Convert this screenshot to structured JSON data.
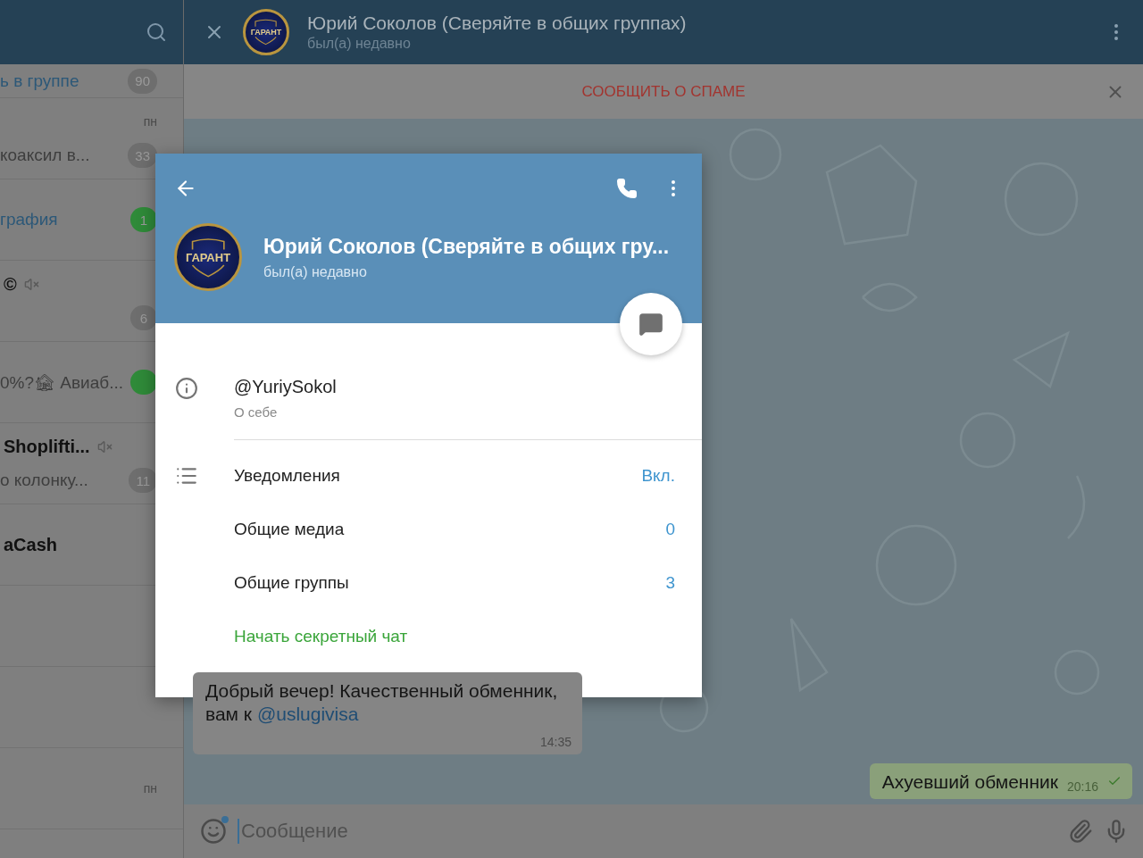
{
  "sidebar": {
    "chats": [
      {
        "muted": false,
        "preview": "ь в группе",
        "media_preview": true,
        "badge": {
          "text": "90",
          "color": "#6e6e6e"
        }
      },
      {
        "muted": false,
        "time": "пн",
        "preview": "коаксил в...",
        "media_preview": false,
        "badge": {
          "text": "33",
          "color": "#6e6e6e"
        }
      },
      {
        "muted": false,
        "preview": "графия",
        "media_preview": true,
        "badge": {
          "text": "1",
          "color": "#2f8a39"
        }
      },
      {
        "title": "©",
        "muted": true,
        "badge": {
          "text": "6",
          "color": "#6e6e6e"
        }
      },
      {
        "muted": false,
        "preview": "0%?🏚 Авиаб...",
        "media_preview": false,
        "badge": {
          "color": "#2f8a39"
        }
      },
      {
        "title": "Shoplifti...",
        "muted": true,
        "preview": "о колонку...",
        "media_preview": false,
        "badge": {
          "text": "11",
          "color": "#6e6e6e"
        }
      },
      {
        "title": "aCash",
        "muted": false
      },
      {
        "muted": false
      },
      {
        "muted": false
      },
      {
        "muted": false,
        "time": "пн"
      }
    ]
  },
  "chat": {
    "header": {
      "title": "Юрий Соколов (Сверяйте в общих группах)",
      "status": "был(а) недавно",
      "avatar_text": "ГАРАНТ"
    },
    "spam_bar": {
      "label": "СООБЩИТЬ О СПАМЕ"
    },
    "messages": [
      {
        "outgoing": false,
        "text": "Добрый вечер! Качественный обменник, вам к",
        "link": "@uslugivisa",
        "time": "14:35"
      },
      {
        "outgoing": true,
        "text": "Ахуевший обменник",
        "time": "20:16",
        "read": true
      }
    ],
    "composer": {
      "placeholder": "Сообщение"
    }
  },
  "profile_dialog": {
    "avatar_text": "ГАРАНТ",
    "name": "Юрий Соколов (Сверяйте в общих гру...",
    "status": "был(а) недавно",
    "info": {
      "username": "@YuriySokol",
      "caption": "О себе"
    },
    "settings": [
      {
        "kind": "notifications",
        "label": "Уведомления",
        "value": "Вкл."
      },
      {
        "kind": "plain",
        "label": "Общие медиа",
        "value": "0"
      },
      {
        "kind": "plain",
        "label": "Общие группы",
        "value": "3"
      },
      {
        "kind": "action",
        "label": "Начать секретный чат"
      }
    ]
  }
}
